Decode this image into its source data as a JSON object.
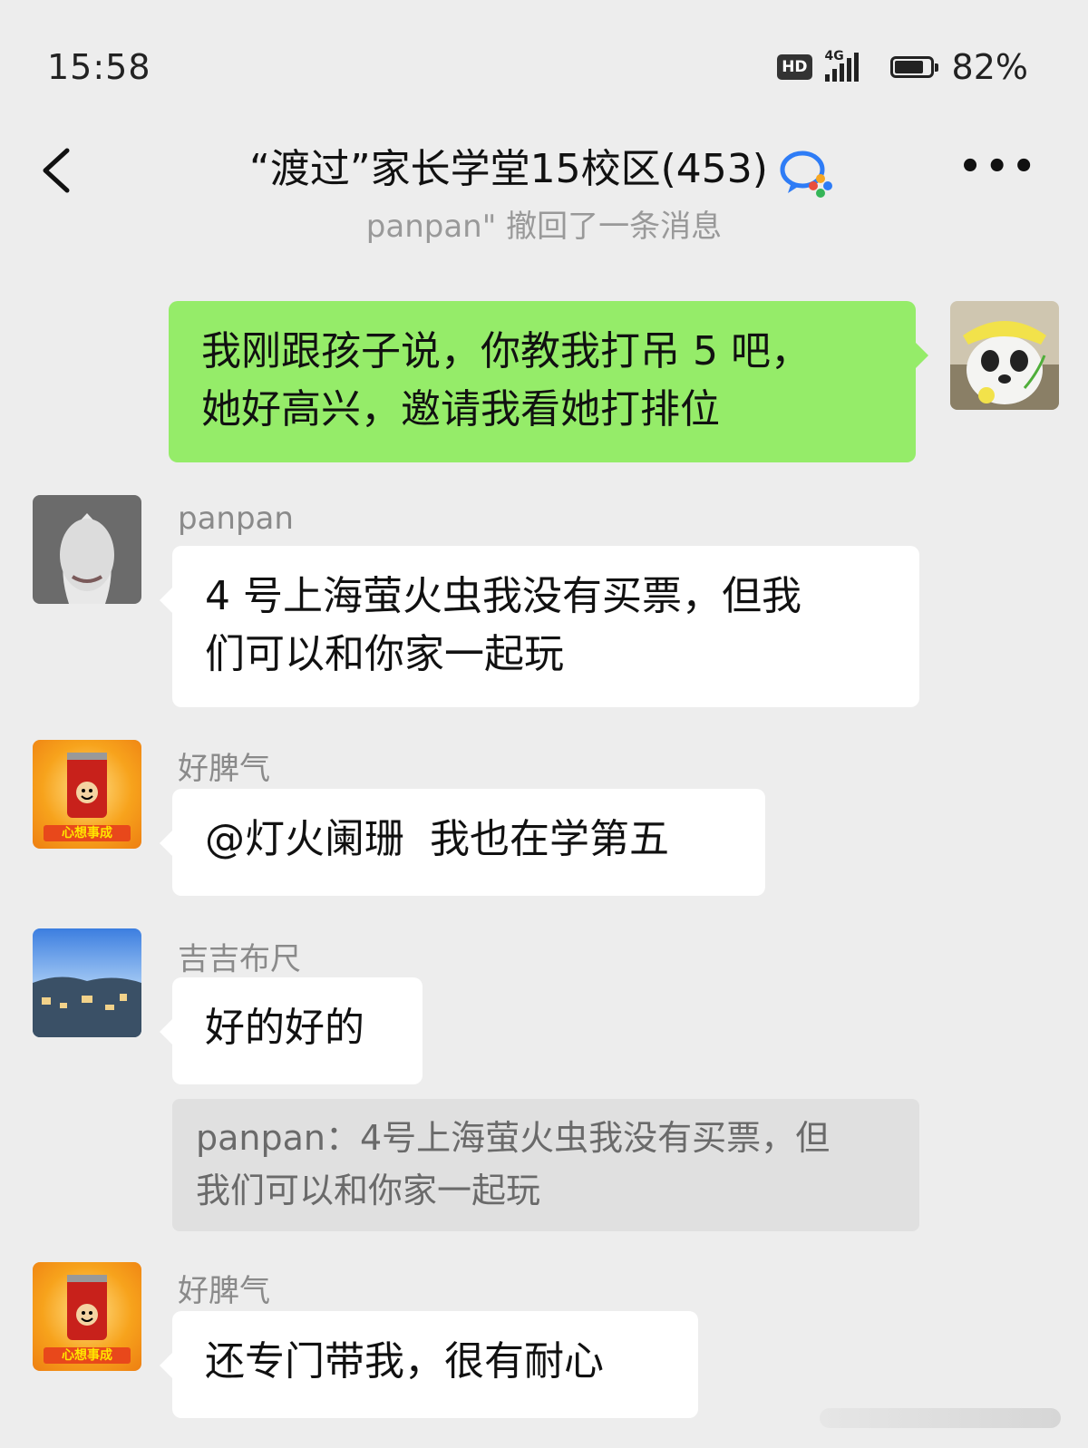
{
  "status": {
    "time": "15:58",
    "hd": "HD",
    "network": "4G",
    "battery_pct": "82%",
    "battery_level": 0.82
  },
  "nav": {
    "title": "“渡过”家长学堂15校区(453)"
  },
  "system_message": "panpan\" 撤回了一条消息",
  "messages": [
    {
      "side": "right",
      "text_lines": [
        "我刚跟孩子说，你教我打吊 5 吧，",
        "她好高兴，邀请我看她打排位"
      ]
    },
    {
      "side": "left",
      "sender": "panpan",
      "text_lines": [
        "4 号上海萤火虫我没有买票，但我",
        "们可以和你家一起玩"
      ]
    },
    {
      "side": "left",
      "sender": "好脾气",
      "text_lines": [
        "@灯火阑珊  我也在学第五"
      ]
    },
    {
      "side": "left",
      "sender": "吉吉布尺",
      "text_lines": [
        "好的好的"
      ],
      "quote_lines": [
        "panpan：4号上海萤火虫我没有买票，但",
        "我们可以和你家一起玩"
      ]
    },
    {
      "side": "left",
      "sender": "好脾气",
      "text_lines": [
        "还专门带我，很有耐心"
      ]
    }
  ],
  "avatar_caption": "心想事成",
  "colors": {
    "background": "#ededed",
    "own_bubble": "#95ec69",
    "other_bubble": "#ffffff",
    "quote_bg": "#e0e0e0"
  }
}
